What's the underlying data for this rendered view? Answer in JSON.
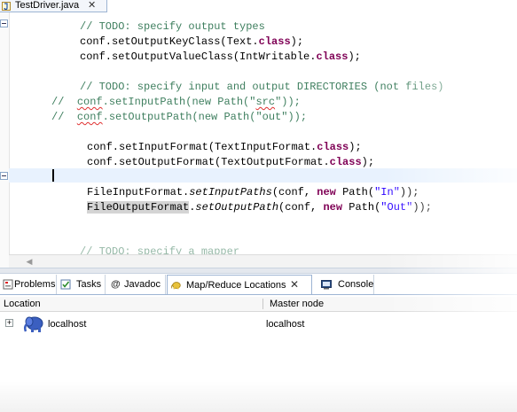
{
  "editor": {
    "tab_label": "TestDriver.java",
    "tab_close": "✕",
    "lines": {
      "l1_comment": "// TODO: specify output types",
      "l2_a": "conf.setOutputKeyClass(Text.",
      "l2_kw": "class",
      "l2_b": ");",
      "l3_a": "conf.setOutputValueClass(IntWritable.",
      "l3_kw": "class",
      "l3_b": ");",
      "l5_comment": "// TODO: specify input and output DIRECTORIES (not files)",
      "l6_prefix": "//  ",
      "l6_sq": "conf",
      "l6_a": ".setInputPath(new Path(\"",
      "l6_str": "src",
      "l6_b": "\"));",
      "l7_prefix": "//  ",
      "l7_sq": "conf",
      "l7_a": ".setOutputPath(new Path(\"out\"));",
      "l9_a": "conf.setInputFormat(TextInputFormat.",
      "l9_kw": "class",
      "l9_b": ");",
      "l10_a": "conf.setOutputFormat(TextOutputFormat.",
      "l10_kw": "class",
      "l10_b": ");",
      "l12_a": "FileInputFormat.",
      "l12_it": "setInputPaths",
      "l12_b": "(conf, ",
      "l12_kw": "new",
      "l12_c": " Path(",
      "l12_str": "\"In\"",
      "l12_d": "));",
      "l13_occ": "FileOutputFormat",
      "l13_a": ".",
      "l13_it": "setOutputPath",
      "l13_b": "(conf, ",
      "l13_kw": "new",
      "l13_c": " Path(",
      "l13_str": "\"Out\"",
      "l13_d": "));",
      "l15_comment": "// TODO: specify a mapper"
    }
  },
  "views": {
    "tabs": [
      {
        "label": "Problems"
      },
      {
        "label": "Tasks"
      },
      {
        "label": "Javadoc"
      },
      {
        "label": "Map/Reduce Locations"
      },
      {
        "label": "Console"
      }
    ],
    "javadoc_glyph": "@",
    "close_glyph": "✕"
  },
  "table": {
    "columns": [
      "Location",
      "Master node"
    ],
    "rows": [
      {
        "location": "localhost",
        "master_node": "localhost",
        "expand": "+"
      }
    ]
  },
  "colors": {
    "keyword": "#7f0055",
    "string": "#2a00ff",
    "comment": "#3f7f5f",
    "javadoc_comment": "#3f7f9f",
    "current_line": "#e8f2fe",
    "elephant": "#3b5fc0"
  }
}
